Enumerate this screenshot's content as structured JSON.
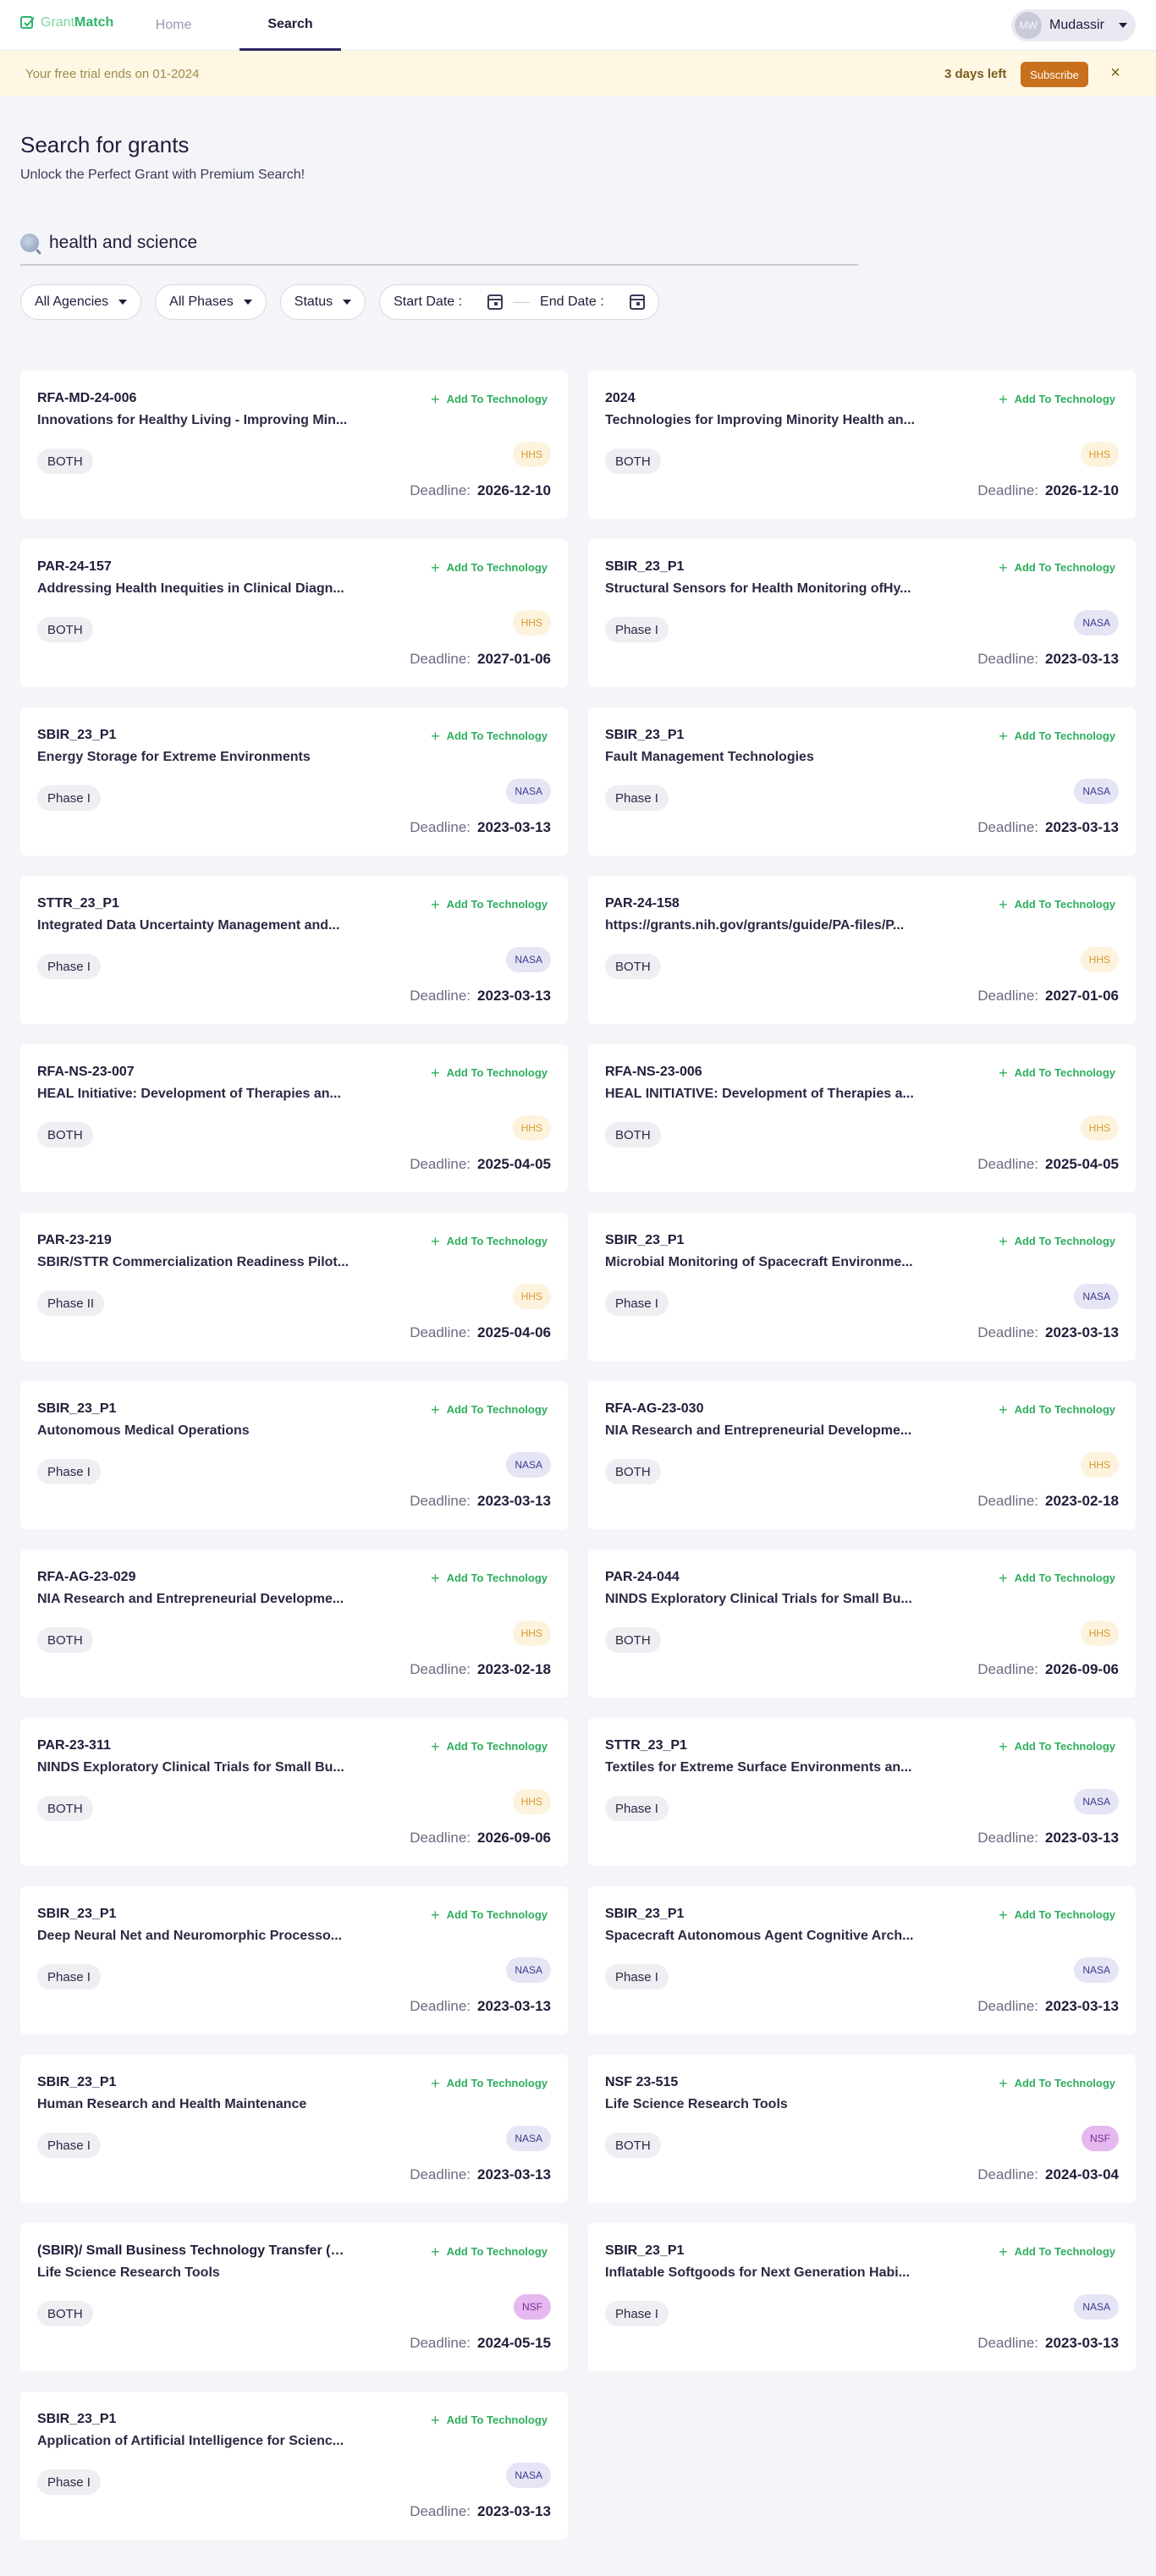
{
  "nav": {
    "logo": {
      "part1": "Grant",
      "part2": "Match"
    },
    "tabs": [
      {
        "label": "Home"
      },
      {
        "label": "Search"
      }
    ],
    "active_tab": "Search",
    "user": {
      "initials": "MW",
      "name": "Mudassir"
    }
  },
  "banner": {
    "message": "Your free trial ends on 01-2024",
    "days_left": "3 days left",
    "subscribe_label": "Subscribe",
    "close_glyph": "×"
  },
  "header": {
    "title": "Search for grants",
    "subtitle": "Unlock the Perfect Grant with Premium Search!"
  },
  "search": {
    "value": "health and science"
  },
  "filters": {
    "agencies": "All Agencies",
    "phases": "All Phases",
    "status": "Status",
    "start_date": "Start Date :",
    "end_date": "End Date :"
  },
  "card_labels": {
    "add": "Add To Technology",
    "deadline": "Deadline:"
  },
  "grants": [
    {
      "code": "RFA-MD-24-006",
      "title": "Innovations for Healthy Living - Improving Min...",
      "phase": "BOTH",
      "agency": "HHS",
      "deadline": "2026-12-10"
    },
    {
      "code": "2024",
      "title": "Technologies for Improving Minority Health an...",
      "phase": "BOTH",
      "agency": "HHS",
      "deadline": "2026-12-10"
    },
    {
      "code": "PAR-24-157",
      "title": "Addressing Health Inequities in Clinical Diagn...",
      "phase": "BOTH",
      "agency": "HHS",
      "deadline": "2027-01-06"
    },
    {
      "code": "SBIR_23_P1",
      "title": "Structural Sensors for Health Monitoring ofHy...",
      "phase": "Phase I",
      "agency": "NASA",
      "deadline": "2023-03-13"
    },
    {
      "code": "SBIR_23_P1",
      "title": "Energy Storage for Extreme Environments",
      "phase": "Phase I",
      "agency": "NASA",
      "deadline": "2023-03-13"
    },
    {
      "code": "SBIR_23_P1",
      "title": "Fault Management Technologies",
      "phase": "Phase I",
      "agency": "NASA",
      "deadline": "2023-03-13"
    },
    {
      "code": "STTR_23_P1",
      "title": "Integrated Data Uncertainty Management and...",
      "phase": "Phase I",
      "agency": "NASA",
      "deadline": "2023-03-13"
    },
    {
      "code": "PAR-24-158",
      "title": "https://grants.nih.gov/grants/guide/PA-files/P...",
      "phase": "BOTH",
      "agency": "HHS",
      "deadline": "2027-01-06"
    },
    {
      "code": "RFA-NS-23-007",
      "title": "HEAL Initiative: Development of Therapies an...",
      "phase": "BOTH",
      "agency": "HHS",
      "deadline": "2025-04-05"
    },
    {
      "code": "RFA-NS-23-006",
      "title": "HEAL INITIATIVE: Development of Therapies a...",
      "phase": "BOTH",
      "agency": "HHS",
      "deadline": "2025-04-05"
    },
    {
      "code": "PAR-23-219",
      "title": "SBIR/STTR Commercialization Readiness Pilot...",
      "phase": "Phase II",
      "agency": "HHS",
      "deadline": "2025-04-06"
    },
    {
      "code": "SBIR_23_P1",
      "title": "Microbial Monitoring of Spacecraft Environme...",
      "phase": "Phase I",
      "agency": "NASA",
      "deadline": "2023-03-13"
    },
    {
      "code": "SBIR_23_P1",
      "title": "Autonomous Medical Operations",
      "phase": "Phase I",
      "agency": "NASA",
      "deadline": "2023-03-13"
    },
    {
      "code": "RFA-AG-23-030",
      "title": "NIA Research and Entrepreneurial Developme...",
      "phase": "BOTH",
      "agency": "HHS",
      "deadline": "2023-02-18"
    },
    {
      "code": "RFA-AG-23-029",
      "title": "NIA Research and Entrepreneurial Developme...",
      "phase": "BOTH",
      "agency": "HHS",
      "deadline": "2023-02-18"
    },
    {
      "code": "PAR-24-044",
      "title": "NINDS Exploratory Clinical Trials for Small Bu...",
      "phase": "BOTH",
      "agency": "HHS",
      "deadline": "2026-09-06"
    },
    {
      "code": "PAR-23-311",
      "title": "NINDS Exploratory Clinical Trials for Small Bu...",
      "phase": "BOTH",
      "agency": "HHS",
      "deadline": "2026-09-06"
    },
    {
      "code": "STTR_23_P1",
      "title": "Textiles for Extreme Surface Environments an...",
      "phase": "Phase I",
      "agency": "NASA",
      "deadline": "2023-03-13"
    },
    {
      "code": "SBIR_23_P1",
      "title": "Deep Neural Net and Neuromorphic Processo...",
      "phase": "Phase I",
      "agency": "NASA",
      "deadline": "2023-03-13"
    },
    {
      "code": "SBIR_23_P1",
      "title": "Spacecraft Autonomous Agent Cognitive Arch...",
      "phase": "Phase I",
      "agency": "NASA",
      "deadline": "2023-03-13"
    },
    {
      "code": "SBIR_23_P1",
      "title": "Human Research and Health Maintenance",
      "phase": "Phase I",
      "agency": "NASA",
      "deadline": "2023-03-13"
    },
    {
      "code": "NSF 23-515",
      "title": "Life Science Research Tools",
      "phase": "BOTH",
      "agency": "NSF",
      "deadline": "2024-03-04"
    },
    {
      "code": "(SBIR)/ Small Business Technology Transfer (S...",
      "title": "Life Science Research Tools",
      "phase": "BOTH",
      "agency": "NSF",
      "deadline": "2024-05-15"
    },
    {
      "code": "SBIR_23_P1",
      "title": "Inflatable Softgoods for Next Generation Habi...",
      "phase": "Phase I",
      "agency": "NASA",
      "deadline": "2023-03-13"
    },
    {
      "code": "SBIR_23_P1",
      "title": "Application of Artificial Intelligence for Scienc...",
      "phase": "Phase I",
      "agency": "NASA",
      "deadline": "2023-03-13"
    }
  ]
}
